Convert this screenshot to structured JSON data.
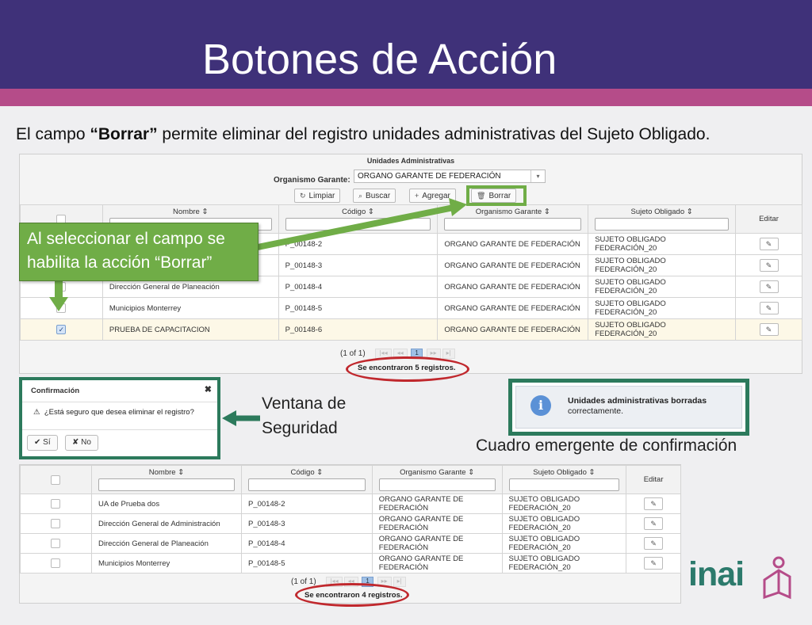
{
  "slide": {
    "title": "Botones de Acción",
    "subtitle_pre": "El campo ",
    "subtitle_bold": "“Borrar”",
    "subtitle_post": " permite eliminar del registro unidades administrativas del Sujeto Obligado."
  },
  "top_panel": {
    "heading": "Unidades Administrativas",
    "garante_label": "Organismo Garante:",
    "garante_value": "ORGANO GARANTE DE FEDERACIÓN",
    "buttons": {
      "limpiar": "Limpiar",
      "buscar": "Buscar",
      "agregar": "Agregar",
      "borrar": "Borrar"
    },
    "columns": {
      "nombre": "Nombre",
      "codigo": "Código",
      "organismo": "Organismo Garante",
      "sujeto": "Sujeto Obligado",
      "editar": "Editar"
    },
    "rows": [
      {
        "nombre": "",
        "codigo": "P_00148-2",
        "organismo": "ORGANO GARANTE DE FEDERACIÓN",
        "sujeto": "SUJETO OBLIGADO FEDERACIÓN_20",
        "checked": false
      },
      {
        "nombre": "",
        "codigo": "P_00148-3",
        "organismo": "ORGANO GARANTE DE FEDERACIÓN",
        "sujeto": "SUJETO OBLIGADO FEDERACIÓN_20",
        "checked": false
      },
      {
        "nombre": "Dirección General de Planeación",
        "codigo": "P_00148-4",
        "organismo": "ORGANO GARANTE DE FEDERACIÓN",
        "sujeto": "SUJETO OBLIGADO FEDERACIÓN_20",
        "checked": false
      },
      {
        "nombre": "Municipios Monterrey",
        "codigo": "P_00148-5",
        "organismo": "ORGANO GARANTE DE FEDERACIÓN",
        "sujeto": "SUJETO OBLIGADO FEDERACIÓN_20",
        "checked": false
      },
      {
        "nombre": "PRUEBA DE CAPACITACION",
        "codigo": "P_00148-6",
        "organismo": "ORGANO GARANTE DE FEDERACIÓN",
        "sujeto": "SUJETO OBLIGADO FEDERACIÓN_20",
        "checked": true
      }
    ],
    "pager": "(1 of 1)",
    "page": "1",
    "found": "Se encontraron 5 registros."
  },
  "callout": {
    "text": "Al seleccionar el campo se habilita la acción “Borrar”"
  },
  "dialog": {
    "title": "Confirmación",
    "message": "¿Está seguro que desea eliminar el registro?",
    "yes": "Sí",
    "no": "No"
  },
  "ventana_label": {
    "line1": "Ventana de",
    "line2": "Seguridad"
  },
  "confirmation": {
    "line1": "Unidades administrativas borradas",
    "line2": "correctamente.",
    "caption": "Cuadro emergente de confirmación"
  },
  "bottom_panel": {
    "columns": {
      "nombre": "Nombre",
      "codigo": "Código",
      "organismo": "Organismo Garante",
      "sujeto": "Sujeto Obligado",
      "editar": "Editar"
    },
    "rows": [
      {
        "nombre": "UA de Prueba dos",
        "codigo": "P_00148-2",
        "organismo": "ORGANO GARANTE DE FEDERACIÓN",
        "sujeto": "SUJETO OBLIGADO FEDERACIÓN_20"
      },
      {
        "nombre": "Dirección General de Administración",
        "codigo": "P_00148-3",
        "organismo": "ORGANO GARANTE DE FEDERACIÓN",
        "sujeto": "SUJETO OBLIGADO FEDERACIÓN_20"
      },
      {
        "nombre": "Dirección General de Planeación",
        "codigo": "P_00148-4",
        "organismo": "ORGANO GARANTE DE FEDERACIÓN",
        "sujeto": "SUJETO OBLIGADO FEDERACIÓN_20"
      },
      {
        "nombre": "Municipios Monterrey",
        "codigo": "P_00148-5",
        "organismo": "ORGANO GARANTE DE FEDERACIÓN",
        "sujeto": "SUJETO OBLIGADO FEDERACIÓN_20"
      }
    ],
    "pager": "(1 of 1)",
    "page": "1",
    "found": "Se encontraron 4 registros."
  },
  "logo": {
    "text": "inai"
  },
  "colors": {
    "header": "#3f3179",
    "stripe": "#b54c89",
    "green": "#70ad47",
    "dark_green": "#2c7a5c",
    "ellipse": "#c0282d"
  }
}
